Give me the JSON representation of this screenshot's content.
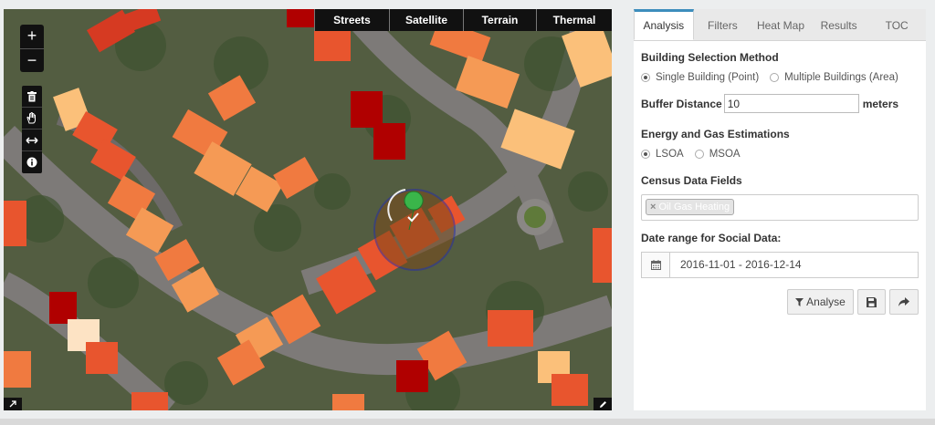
{
  "map": {
    "layer_tabs": [
      "Streets",
      "Satellite",
      "Terrain",
      "Thermal"
    ],
    "zoom": {
      "in": "+",
      "out": "−"
    },
    "tools": [
      "trash-icon",
      "hand-icon",
      "measure-icon",
      "info-icon"
    ],
    "heat_colors": [
      "#b00000",
      "#d63a22",
      "#e8552e",
      "#f07a40",
      "#f59a55",
      "#fbc07a",
      "#fde3c4"
    ]
  },
  "panel": {
    "tabs": [
      {
        "label": "Analysis",
        "active": true
      },
      {
        "label": "Filters",
        "active": false
      },
      {
        "label": "Heat Map",
        "active": false
      },
      {
        "label": "Results",
        "active": false
      },
      {
        "label": "TOC",
        "active": false
      }
    ],
    "building_selection": {
      "label": "Building Selection Method",
      "options": [
        "Single Building (Point)",
        "Multiple Buildings (Area)"
      ],
      "selected": "Single Building (Point)"
    },
    "buffer": {
      "label": "Buffer Distance",
      "value": "10",
      "unit": "meters"
    },
    "energy": {
      "label": "Energy and Gas Estimations",
      "options": [
        "LSOA",
        "MSOA"
      ],
      "selected": "LSOA"
    },
    "census": {
      "label": "Census Data Fields",
      "tag": "Oil Gas Heating"
    },
    "date_range": {
      "label": "Date range for Social Data:",
      "value": "2016-11-01 - 2016-12-14"
    },
    "actions": {
      "analyse": "Analyse"
    },
    "accent": "#3c8dbc"
  }
}
